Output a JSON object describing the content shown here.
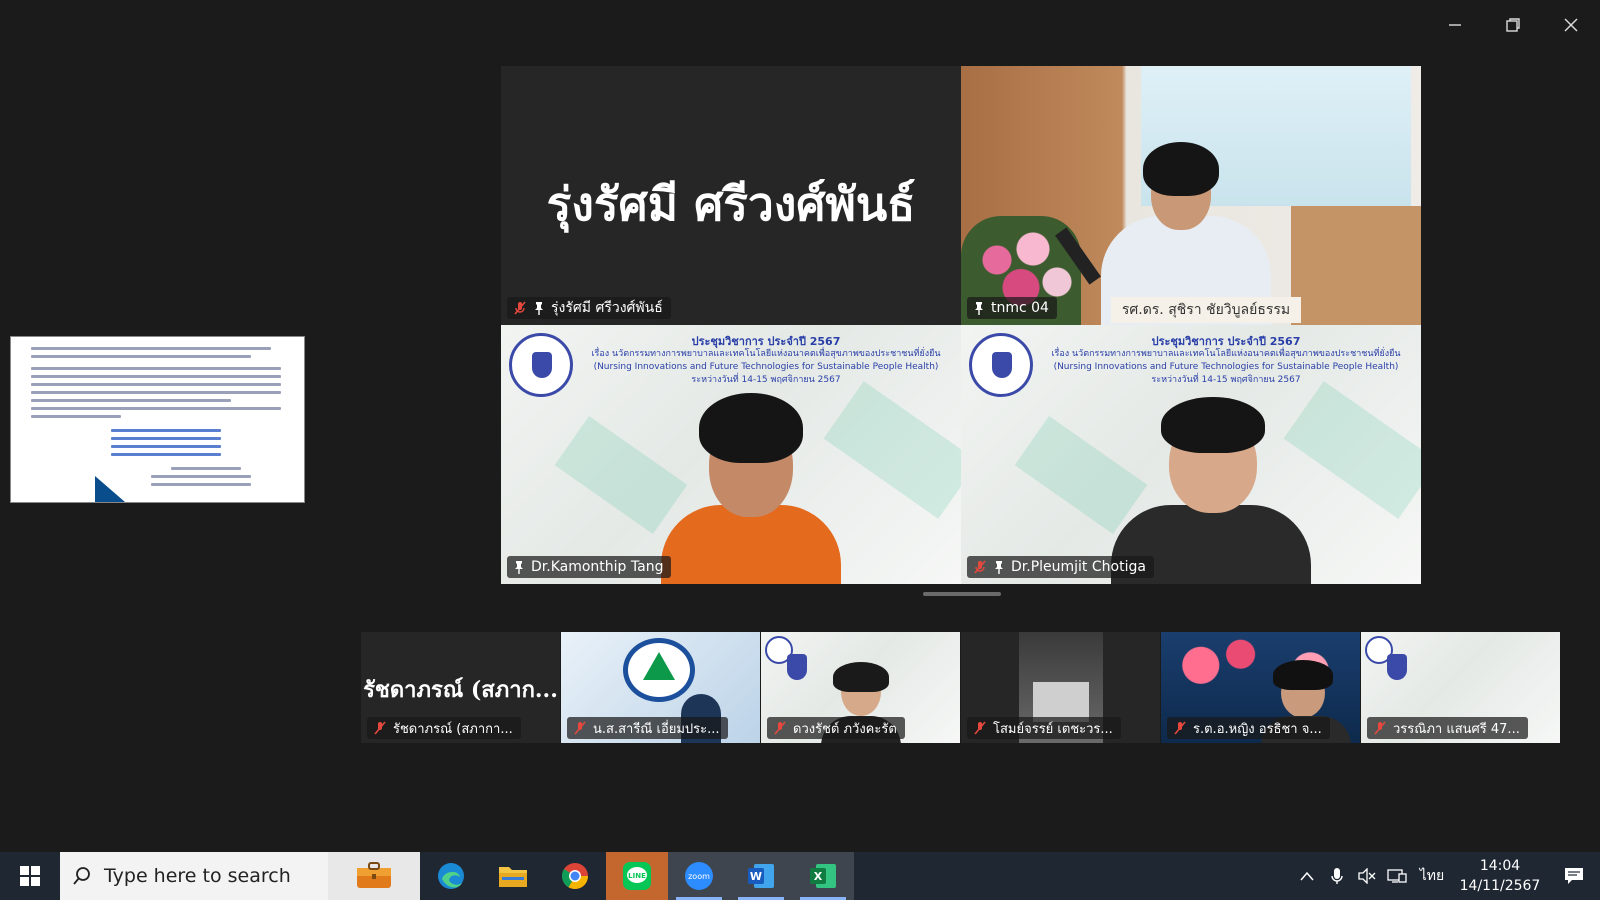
{
  "window": {
    "minimize_icon": "minimize-icon",
    "restore_icon": "restore-icon",
    "close_icon": "close-icon"
  },
  "main_grid": {
    "tiles": [
      {
        "name": "รุ่งรัศมี ศรีวงศ์พันธ์",
        "display_name": "รุ่งรัศมี ศรีวงศ์พันธ์",
        "muted": true,
        "pinned": true,
        "video": false
      },
      {
        "name": "tnmc 04",
        "muted": false,
        "pinned": true,
        "video": true,
        "podium_sign": "รศ.ดร. สุชิรา ชัยวิบูลย์ธรรม"
      },
      {
        "name": "Dr.Kamonthip Tang",
        "muted": false,
        "pinned": true,
        "video": true,
        "active_speaker": true
      },
      {
        "name": "Dr.Pleumjit Chotiga",
        "muted": true,
        "pinned": true,
        "video": true
      }
    ],
    "backdrop": {
      "line1": "ประชุมวิชาการ ประจำปี 2567",
      "line2": "เรื่อง นวัตกรรมทางการพยาบาลและเทคโนโลยีแห่งอนาคตเพื่อสุขภาพของประชาชนที่ยั่งยืน",
      "line3": "(Nursing Innovations and Future Technologies for Sustainable People Health)",
      "line4": "ระหว่างวันที่ 14-15 พฤศจิกายน 2567"
    }
  },
  "filmstrip": [
    {
      "name": "รัชดาภรณ์ (สภากา...",
      "display_name": "รัชดาภรณ์ (สภาก...",
      "muted": true,
      "video": false
    },
    {
      "name": "น.ส.สารีณี เอี่ยมประ...",
      "muted": true,
      "video": true
    },
    {
      "name": "ดวงรัชต์ ภวังคะรัต",
      "muted": true,
      "video": true
    },
    {
      "name": "โสมย์จรรย์ เตชะวร...",
      "muted": true,
      "video": true
    },
    {
      "name": "ร.ต.อ.หญิง อรธิชา จ...",
      "muted": true,
      "video": true
    },
    {
      "name": "วรรณิภา แสนศรี 47...",
      "muted": true,
      "video": true
    }
  ],
  "taskbar": {
    "search_placeholder": "Type here to search",
    "apps": [
      "edge",
      "file-explorer",
      "chrome",
      "line",
      "zoom",
      "word",
      "excel"
    ],
    "tray": {
      "language": "ไทย",
      "time": "14:04",
      "date": "14/11/2567"
    }
  },
  "colors": {
    "active_speaker_border": "#3ddc84",
    "muted_icon": "#e5483d",
    "taskbar_bg": "#1f2733"
  }
}
